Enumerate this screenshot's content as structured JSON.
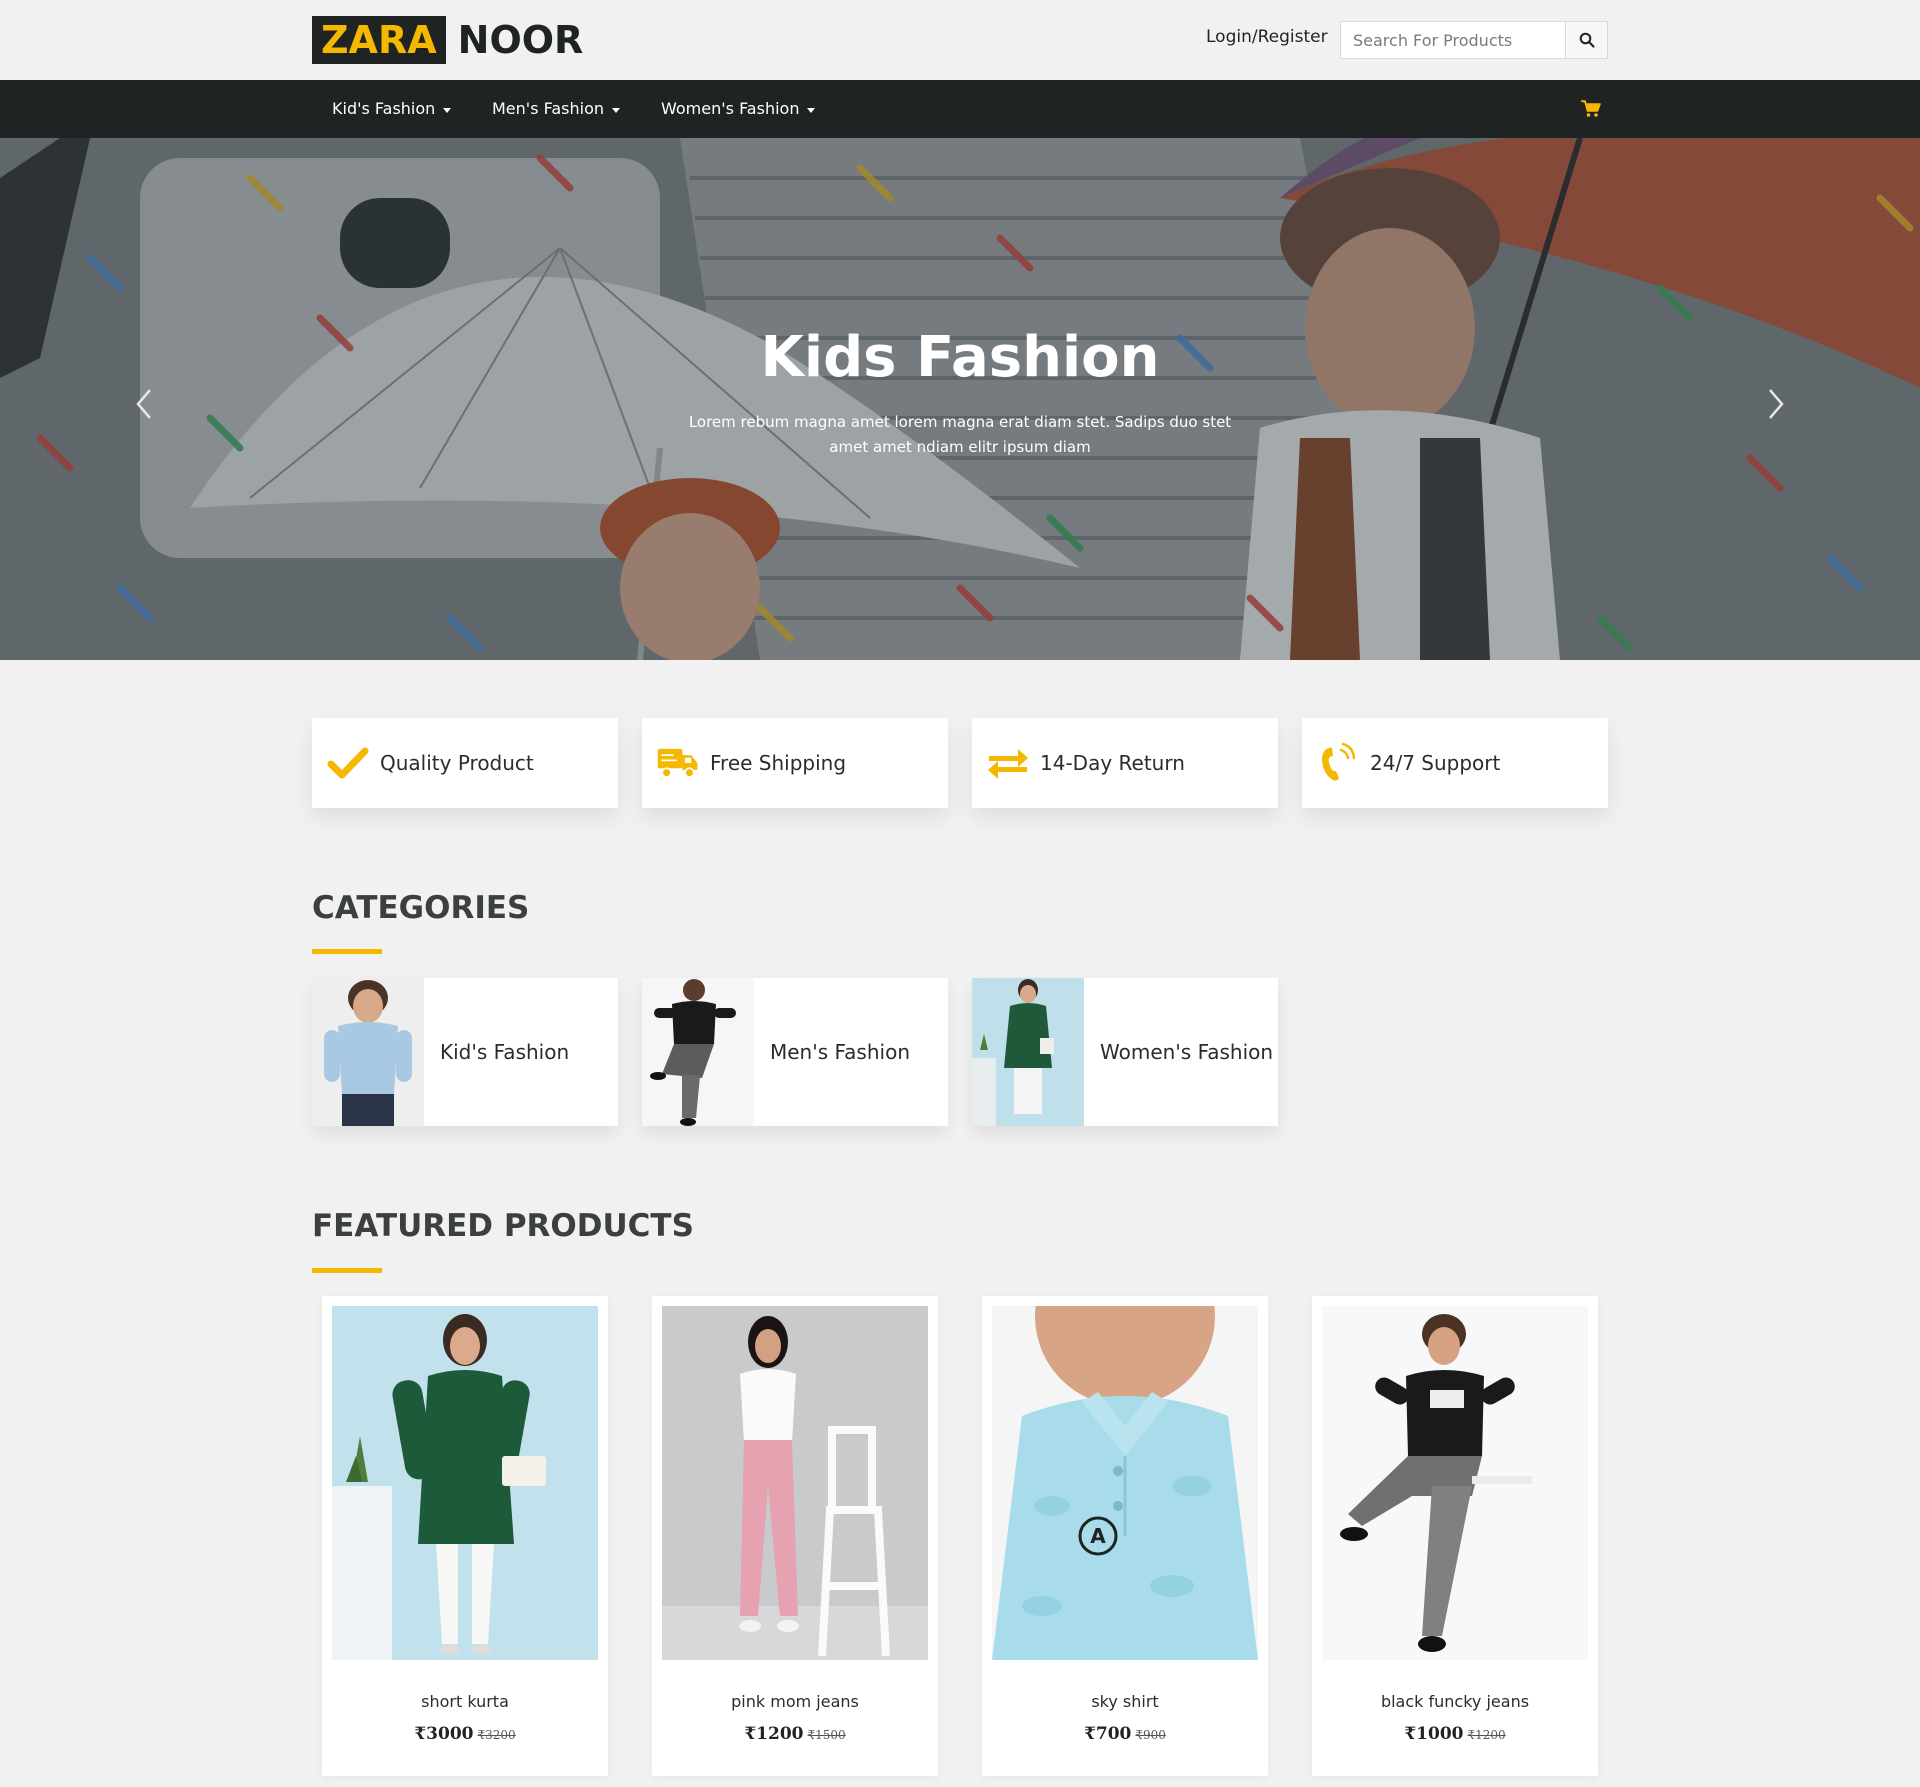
{
  "brand": {
    "part1": "ZARA",
    "part2": "NOOR"
  },
  "header": {
    "login_label": "Login/Register",
    "search_placeholder": "Search For Products"
  },
  "nav": {
    "items": [
      {
        "label": "Kid's Fashion"
      },
      {
        "label": "Men's Fashion"
      },
      {
        "label": "Women's Fashion"
      }
    ],
    "cart_icon": "shopping-cart-icon"
  },
  "hero": {
    "title": "Kids Fashion",
    "subtitle": "Lorem rebum magna amet lorem magna erat diam stet. Sadips duo stet amet amet ndiam elitr ipsum diam"
  },
  "features": [
    {
      "label": "Quality Product",
      "icon": "check-icon"
    },
    {
      "label": "Free Shipping",
      "icon": "truck-icon"
    },
    {
      "label": "14-Day Return",
      "icon": "exchange-icon"
    },
    {
      "label": "24/7 Support",
      "icon": "phone-icon"
    }
  ],
  "categories": {
    "title": "CATEGORIES",
    "items": [
      {
        "label": "Kid's Fashion"
      },
      {
        "label": "Men's Fashion"
      },
      {
        "label": "Women's Fashion"
      }
    ]
  },
  "featured": {
    "title": "FEATURED PRODUCTS",
    "products": [
      {
        "name": "short kurta",
        "price": "₹3000",
        "old_price": "₹3200"
      },
      {
        "name": "pink mom jeans",
        "price": "₹1200",
        "old_price": "₹1500"
      },
      {
        "name": "sky shirt",
        "price": "₹700",
        "old_price": "₹900"
      },
      {
        "name": "black funcky jeans",
        "price": "₹1000",
        "old_price": "₹1200"
      }
    ]
  },
  "colors": {
    "accent": "#f5b800",
    "dark": "#1f2323",
    "background": "#f1f1f1"
  }
}
